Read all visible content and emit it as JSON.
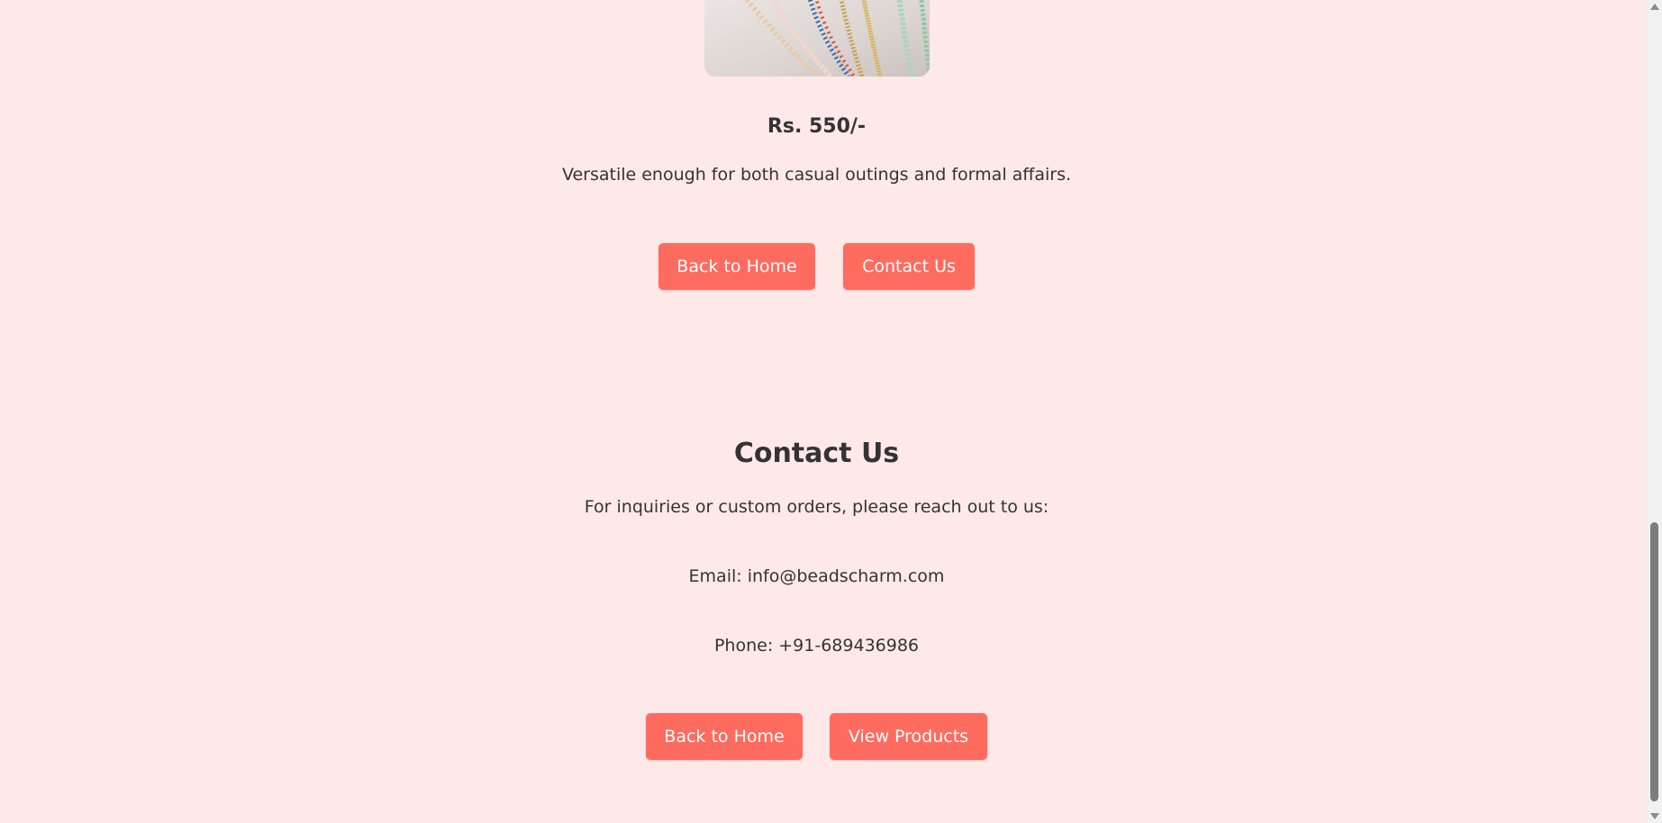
{
  "product": {
    "image_alt": "Beaded necklaces",
    "price": "Rs. 550/-",
    "description": "Versatile enough for both casual outings and formal affairs.",
    "buttons": {
      "back_home": "Back to Home",
      "contact": "Contact Us"
    }
  },
  "contact": {
    "title": "Contact Us",
    "intro": "For inquiries or custom orders, please reach out to us:",
    "email": "Email: info@beadscharm.com",
    "phone": "Phone: +91-689436986",
    "buttons": {
      "back_home": "Back to Home",
      "view_products": "View Products"
    }
  },
  "colors": {
    "background": "#ffe9e8",
    "button": "#ff6b5f",
    "button_text": "#ffffff",
    "text": "#333333"
  }
}
